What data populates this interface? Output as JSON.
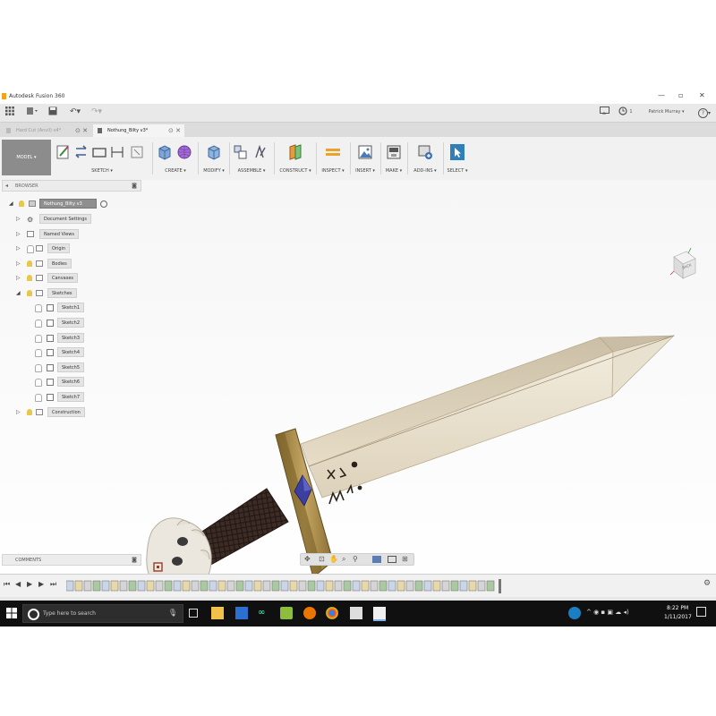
{
  "window": {
    "title": "Autodesk Fusion 360",
    "controls": {
      "minimize": "—",
      "maximize": "▫",
      "close": "✕"
    }
  },
  "quick_access": {
    "user_name": "Patrick Murray ▾",
    "job_count": "1",
    "help_label": "?"
  },
  "tabs": [
    {
      "label": "Hard Cut (Anvil) v4*",
      "active": false
    },
    {
      "label": "Nothung_Bilty v3*",
      "active": true
    }
  ],
  "ribbon": {
    "workspace": "MODEL ▾",
    "groups": [
      {
        "label": "SKETCH ▾"
      },
      {
        "label": "CREATE ▾"
      },
      {
        "label": "MODIFY ▾"
      },
      {
        "label": "ASSEMBLE ▾"
      },
      {
        "label": "CONSTRUCT ▾"
      },
      {
        "label": "INSPECT ▾"
      },
      {
        "label": "INSERT ▾"
      },
      {
        "label": "MAKE ▾"
      },
      {
        "label": "ADD-INS ▾"
      },
      {
        "label": "SELECT ▾"
      }
    ]
  },
  "browser": {
    "header": "BROWSER",
    "root": "Nothung_Bilty v3",
    "nodes": [
      {
        "label": "Document Settings",
        "icon": "gear-icon"
      },
      {
        "label": "Named Views",
        "icon": "folder-icon"
      },
      {
        "label": "Origin",
        "icon": "folder-icon"
      },
      {
        "label": "Bodies",
        "icon": "folder-icon"
      },
      {
        "label": "Canvases",
        "icon": "folder-icon"
      },
      {
        "label": "Sketches",
        "icon": "folder-icon"
      }
    ],
    "sketches": [
      "Sketch1",
      "Sketch2",
      "Sketch3",
      "Sketch4",
      "Sketch5",
      "Sketch6",
      "Sketch7"
    ],
    "last_node": "Construction"
  },
  "comments": {
    "label": "COMMENTS"
  },
  "viewcube": {
    "face_label": "BACK"
  },
  "taskbar": {
    "search_placeholder": "Type here to search",
    "time": "8:22 PM",
    "date": "1/11/2017"
  },
  "colors": {
    "accent": "#1f6fb2",
    "blade": "#e6dcc6",
    "guard": "#a8894a",
    "grip": "#3a2a24",
    "gem": "#3a3fa0"
  }
}
